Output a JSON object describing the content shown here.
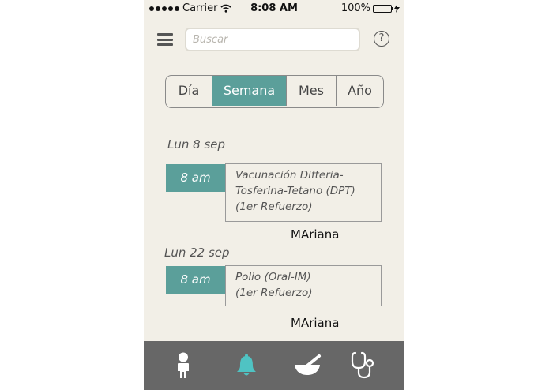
{
  "status_bar": {
    "carrier": "Carrier",
    "time": "8:08 AM",
    "battery": "100%",
    "battery_level": 1.0
  },
  "header": {
    "search_placeholder": "Buscar",
    "help_label": "?"
  },
  "view_tabs": {
    "items": [
      {
        "label": "Día",
        "active": false
      },
      {
        "label": "Semana",
        "active": true
      },
      {
        "label": "Mes",
        "active": false
      },
      {
        "label": "Año",
        "active": false
      }
    ]
  },
  "events": [
    {
      "date": "Lun 8 sep",
      "time": "8 am",
      "lines": [
        "Vacunación Difteria-",
        "Tosferina-Tetano (DPT)",
        "(1er Refuerzo)"
      ],
      "person": "MAriana"
    },
    {
      "date": "Lun 22 sep",
      "time": "8 am",
      "lines": [
        "Polio (Oral-IM)",
        "(1er Refuerzo)"
      ],
      "person": "MAriana"
    }
  ],
  "tab_bar": {
    "items": [
      {
        "icon": "child-icon",
        "active": false
      },
      {
        "icon": "bell-icon",
        "active": true
      },
      {
        "icon": "mortar-pestle-icon",
        "active": false
      },
      {
        "icon": "stethoscope-icon",
        "active": false
      }
    ]
  },
  "colors": {
    "accent": "#5b9f9a",
    "active_tab_icon": "#4fc3c3",
    "background": "#f2efe7",
    "tab_bar": "#676767"
  }
}
